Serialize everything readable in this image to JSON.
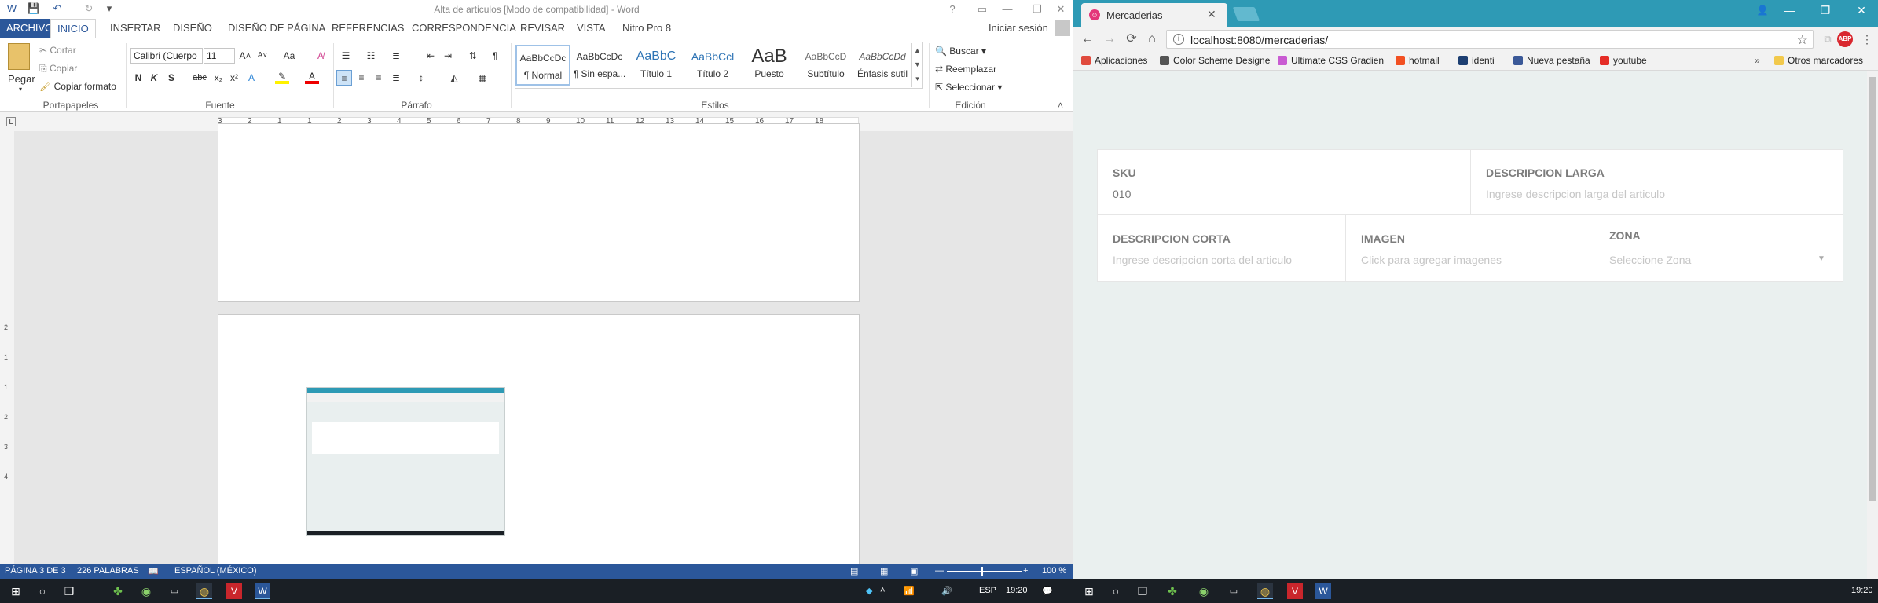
{
  "word": {
    "title": "Alta de articulos [Modo de compatibilidad] - Word",
    "window_controls": [
      "?",
      "—",
      "❐",
      "✕"
    ],
    "tabs": [
      "ARCHIVO",
      "INICIO",
      "INSERTAR",
      "DISEÑO",
      "DISEÑO DE PÁGINA",
      "REFERENCIAS",
      "CORRESPONDENCIA",
      "REVISAR",
      "VISTA",
      "Nitro Pro 8"
    ],
    "active_tab": "INICIO",
    "signin": "Iniciar sesión",
    "clipboard": {
      "paste": "Pegar",
      "cut": "Cortar",
      "copy": "Copiar",
      "format_painter": "Copiar formato",
      "label": "Portapapeles"
    },
    "font": {
      "name": "Calibri (Cuerpo",
      "size": "11",
      "label": "Fuente",
      "bold": "N",
      "italic": "K",
      "underline": "S",
      "strike": "abc",
      "sub": "x₂",
      "sup": "x²",
      "case": "Aa",
      "grow": "A",
      "shrink": "A"
    },
    "paragraph": {
      "label": "Párrafo"
    },
    "styles": {
      "label": "Estilos",
      "items": [
        {
          "sample": "AaBbCcDc",
          "name": "¶ Normal"
        },
        {
          "sample": "AaBbCcDc",
          "name": "¶ Sin espa..."
        },
        {
          "sample": "AaBbC",
          "name": "Título 1"
        },
        {
          "sample": "AaBbCcl",
          "name": "Título 2"
        },
        {
          "sample": "AaB",
          "name": "Puesto"
        },
        {
          "sample": "AaBbCcD",
          "name": "Subtítulo"
        },
        {
          "sample": "AaBbCcDd",
          "name": "Énfasis sutil"
        }
      ]
    },
    "editing": {
      "find": "Buscar",
      "replace": "Reemplazar",
      "select": "Seleccionar",
      "label": "Edición"
    },
    "ruler_numbers": [
      "3",
      "2",
      "1",
      "1",
      "2",
      "3",
      "4",
      "5",
      "6",
      "7",
      "8",
      "9",
      "10",
      "11",
      "12",
      "13",
      "14",
      "15",
      "16",
      "17",
      "18"
    ],
    "vruler_numbers": [
      "2",
      "1",
      "1",
      "2",
      "3",
      "4"
    ],
    "status": {
      "page": "PÁGINA 3 DE 3",
      "words": "226 PALABRAS",
      "language": "ESPAÑOL (MÉXICO)",
      "zoom": "100 %"
    }
  },
  "chrome": {
    "tab_title": "Mercaderias",
    "url": "localhost:8080/mercaderias/",
    "bookmarks": [
      {
        "label": "Aplicaciones",
        "icon": "apps-icon",
        "color": "#e04a3d"
      },
      {
        "label": "Color Scheme Designe",
        "icon": "color-scheme-icon",
        "color": "#555555"
      },
      {
        "label": "Ultimate CSS Gradien",
        "icon": "gradient-icon",
        "color": "#c95bd2"
      },
      {
        "label": "hotmail",
        "icon": "windows-icon",
        "color": "#f25022"
      },
      {
        "label": "identi",
        "icon": "identi-icon",
        "color": "#1d3f72"
      },
      {
        "label": "Nueva pestaña",
        "icon": "facebook-icon",
        "color": "#3b5998"
      },
      {
        "label": "youtube",
        "icon": "youtube-icon",
        "color": "#e52d27"
      }
    ],
    "other_bookmarks": "Otros marcadores",
    "form": {
      "sku_label": "SKU",
      "sku_value": "010",
      "long_desc_label": "DESCRIPCION LARGA",
      "long_desc_placeholder": "Ingrese descripcion larga del articulo",
      "short_desc_label": "DESCRIPCION CORTA",
      "short_desc_placeholder": "Ingrese descripcion corta del articulo",
      "image_label": "IMAGEN",
      "image_placeholder": "Click para agregar imagenes",
      "zone_label": "ZONA",
      "zone_placeholder": "Seleccione Zona"
    }
  },
  "taskbar": {
    "language": "ESP",
    "time": "19:20",
    "time_right": "19:20"
  },
  "colors": {
    "word_blue": "#2b579a",
    "chrome_teal": "#2e9ab5",
    "page_bg": "#eaf0ef",
    "taskbar": "#1a1f25"
  }
}
